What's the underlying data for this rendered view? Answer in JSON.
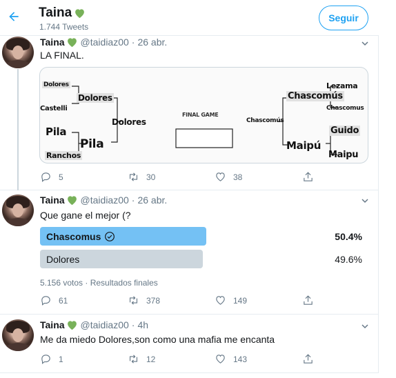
{
  "header": {
    "title": "Taina",
    "tweet_count": "1.744 Tweets",
    "follow_label": "Seguir"
  },
  "colors": {
    "accent": "#1da1f2",
    "heart": "#78b159",
    "poll_winner": "#74c1f4",
    "poll_other": "#ccd6dd",
    "muted_text": "#657786"
  },
  "tweets": [
    {
      "name": "Taina",
      "handle": "@taidiaz00",
      "date": "26 abr.",
      "text": "LA FINAL.",
      "replies": "5",
      "retweets": "30",
      "likes": "38",
      "bracket": {
        "left": [
          "Dolores",
          "Castelli",
          "Pila",
          "Ranchos"
        ],
        "left_round2": [
          "Dolores",
          "Pila"
        ],
        "left_final": "Dolores",
        "center_label": "FINAL GAME",
        "right_final": "Chascomús",
        "right_round2": [
          "Chascomús",
          "Maipú"
        ],
        "right": [
          "Lezama",
          "Chascomus",
          "Guido",
          "Maipu"
        ]
      }
    },
    {
      "name": "Taina",
      "handle": "@taidiaz00",
      "date": "26 abr.",
      "text": "Que gane el mejor (?",
      "poll": {
        "options": [
          {
            "label": "Chascomus",
            "pct": "50.4%",
            "value": 50.4,
            "winner": true
          },
          {
            "label": "Dolores",
            "pct": "49.6%",
            "value": 49.6,
            "winner": false
          }
        ],
        "footer": "5.156 votos · Resultados finales"
      },
      "replies": "61",
      "retweets": "378",
      "likes": "149"
    },
    {
      "name": "Taina",
      "handle": "@taidiaz00",
      "date": "4h",
      "text": "Me da miedo Dolores,son como una mafia me encanta",
      "replies": "1",
      "retweets": "12",
      "likes": "143"
    }
  ],
  "icons": {
    "back": "arrow-left-icon",
    "heart": "green-heart-icon",
    "caret": "chevron-down-icon",
    "reply": "reply-icon",
    "retweet": "retweet-icon",
    "like": "like-icon",
    "share": "share-icon",
    "check": "check-circle-icon"
  }
}
